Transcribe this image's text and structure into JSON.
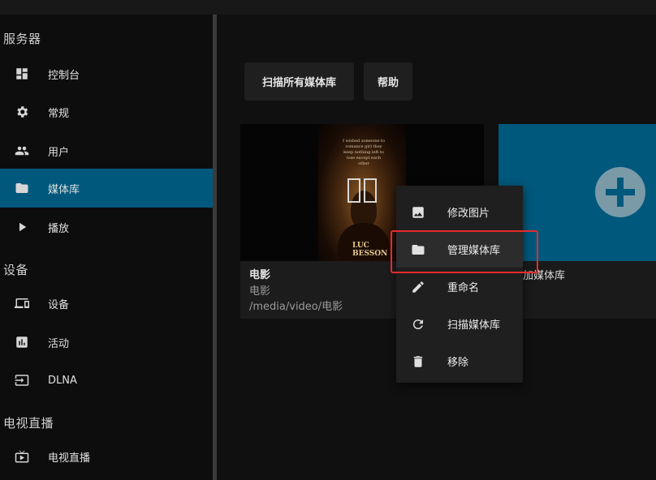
{
  "sidebar": {
    "sections": [
      {
        "title": "服务器"
      },
      {
        "title": "设备"
      },
      {
        "title": "电视直播"
      }
    ],
    "items": [
      {
        "label": "控制台",
        "icon": "dashboard-icon"
      },
      {
        "label": "常规",
        "icon": "gear-icon"
      },
      {
        "label": "用户",
        "icon": "people-icon"
      },
      {
        "label": "媒体库",
        "icon": "folder-icon",
        "active": true
      },
      {
        "label": "播放",
        "icon": "play-icon"
      },
      {
        "label": "设备",
        "icon": "devices-icon"
      },
      {
        "label": "活动",
        "icon": "assessment-icon"
      },
      {
        "label": "DLNA",
        "icon": "input-icon"
      },
      {
        "label": "电视直播",
        "icon": "tv-icon"
      }
    ]
  },
  "toolbar": {
    "scan_all_label": "扫描所有媒体库",
    "help_label": "帮助"
  },
  "library_card": {
    "title": "电影",
    "type": "电影",
    "path": "/media/video/电影",
    "poster_text": "I wished someone to romance girl they keep nothing left to lose except each other",
    "poster_logo": "LUC BESSON"
  },
  "add_card": {
    "title_partial": "加媒体库"
  },
  "context_menu": {
    "items": [
      {
        "label": "修改图片",
        "icon": "image-icon"
      },
      {
        "label": "管理媒体库",
        "icon": "folder-icon",
        "highlighted": true
      },
      {
        "label": "重命名",
        "icon": "pencil-icon"
      },
      {
        "label": "扫描媒体库",
        "icon": "refresh-icon"
      },
      {
        "label": "移除",
        "icon": "trash-icon"
      }
    ]
  },
  "colors": {
    "accent": "#00587c",
    "highlight_border": "#e82a2a",
    "background": "#101010"
  }
}
